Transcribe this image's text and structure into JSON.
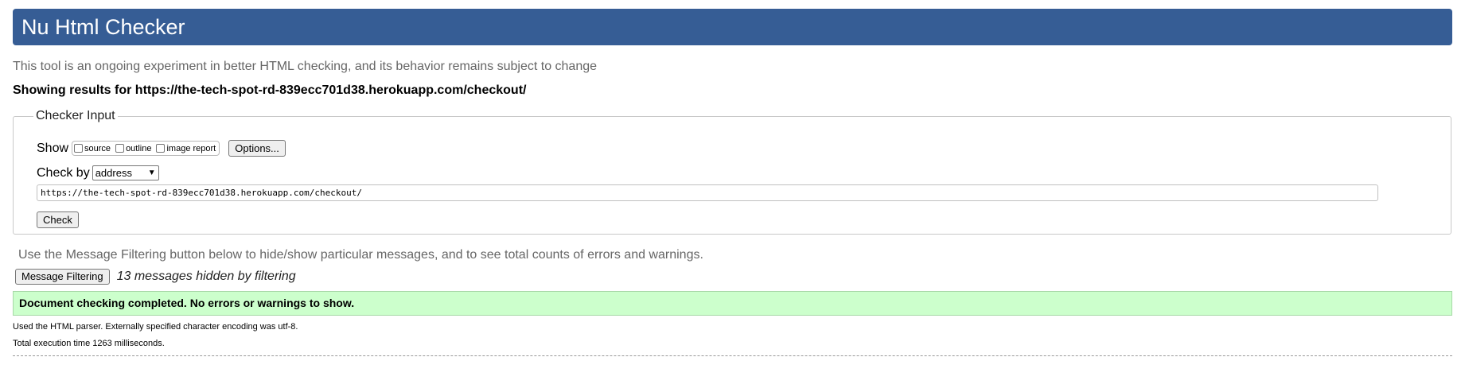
{
  "header": {
    "title": "Nu Html Checker"
  },
  "tagline": "This tool is an ongoing experiment in better HTML checking, and its behavior remains subject to change",
  "showing_results": "Showing results for https://the-tech-spot-rd-839ecc701d38.herokuapp.com/checkout/",
  "checker_input": {
    "legend": "Checker Input",
    "show_label": "Show",
    "options": [
      {
        "label": "source",
        "checked": false
      },
      {
        "label": "outline",
        "checked": false
      },
      {
        "label": "image report",
        "checked": false
      }
    ],
    "options_button": "Options...",
    "check_by_label": "Check by",
    "check_by_value": "address",
    "url_value": "https://the-tech-spot-rd-839ecc701d38.herokuapp.com/checkout/",
    "check_button": "Check"
  },
  "filtering": {
    "info": "Use the Message Filtering button below to hide/show particular messages, and to see total counts of errors and warnings.",
    "button": "Message Filtering",
    "hidden_count": "13 messages hidden by filtering"
  },
  "result": {
    "message": "Document checking completed. No errors or warnings to show.",
    "color": "#ccffcc"
  },
  "footer": {
    "parser_info": "Used the HTML parser. Externally specified character encoding was utf-8.",
    "execution_time": "Total execution time 1263 milliseconds."
  },
  "colors": {
    "header_bg": "#365d95",
    "header_text": "#ffffff"
  }
}
